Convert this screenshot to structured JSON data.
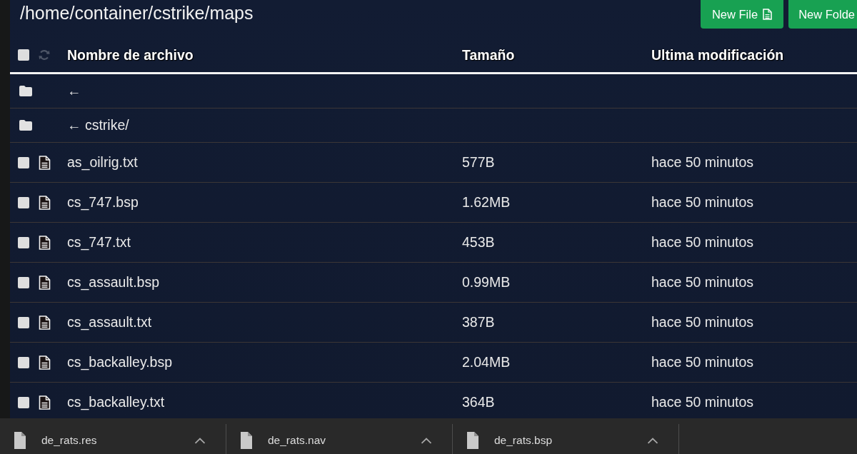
{
  "path": "/home/container/cstrike/maps",
  "buttons": [
    {
      "label": "New File",
      "icon": true
    },
    {
      "label": "New Folde",
      "icon": false
    }
  ],
  "table": {
    "select_all": {
      "checked": false
    },
    "columns": [
      "Nombre de archivo",
      "Tamaño",
      "Ultima modificación"
    ],
    "rows": [
      {
        "kind": "folder",
        "name": "←"
      },
      {
        "kind": "folder",
        "name": "← cstrike/"
      },
      {
        "kind": "file",
        "checked": false,
        "name": "as_oilrig.txt",
        "size": "577B",
        "modified": "hace 50 minutos"
      },
      {
        "kind": "file",
        "checked": false,
        "name": "cs_747.bsp",
        "size": "1.62MB",
        "modified": "hace 50 minutos"
      },
      {
        "kind": "file",
        "checked": false,
        "name": "cs_747.txt",
        "size": "453B",
        "modified": "hace 50 minutos"
      },
      {
        "kind": "file",
        "checked": false,
        "name": "cs_assault.bsp",
        "size": "0.99MB",
        "modified": "hace 50 minutos"
      },
      {
        "kind": "file",
        "checked": false,
        "name": "cs_assault.txt",
        "size": "387B",
        "modified": "hace 50 minutos"
      },
      {
        "kind": "file",
        "checked": false,
        "name": "cs_backalley.bsp",
        "size": "2.04MB",
        "modified": "hace 50 minutos"
      },
      {
        "kind": "file",
        "checked": false,
        "name": "cs_backalley.txt",
        "size": "364B",
        "modified": "hace 50 minutos"
      }
    ]
  },
  "downloads": [
    {
      "name": "de_rats.res"
    },
    {
      "name": "de_rats.nav"
    },
    {
      "name": "de_rats.bsp"
    }
  ]
}
